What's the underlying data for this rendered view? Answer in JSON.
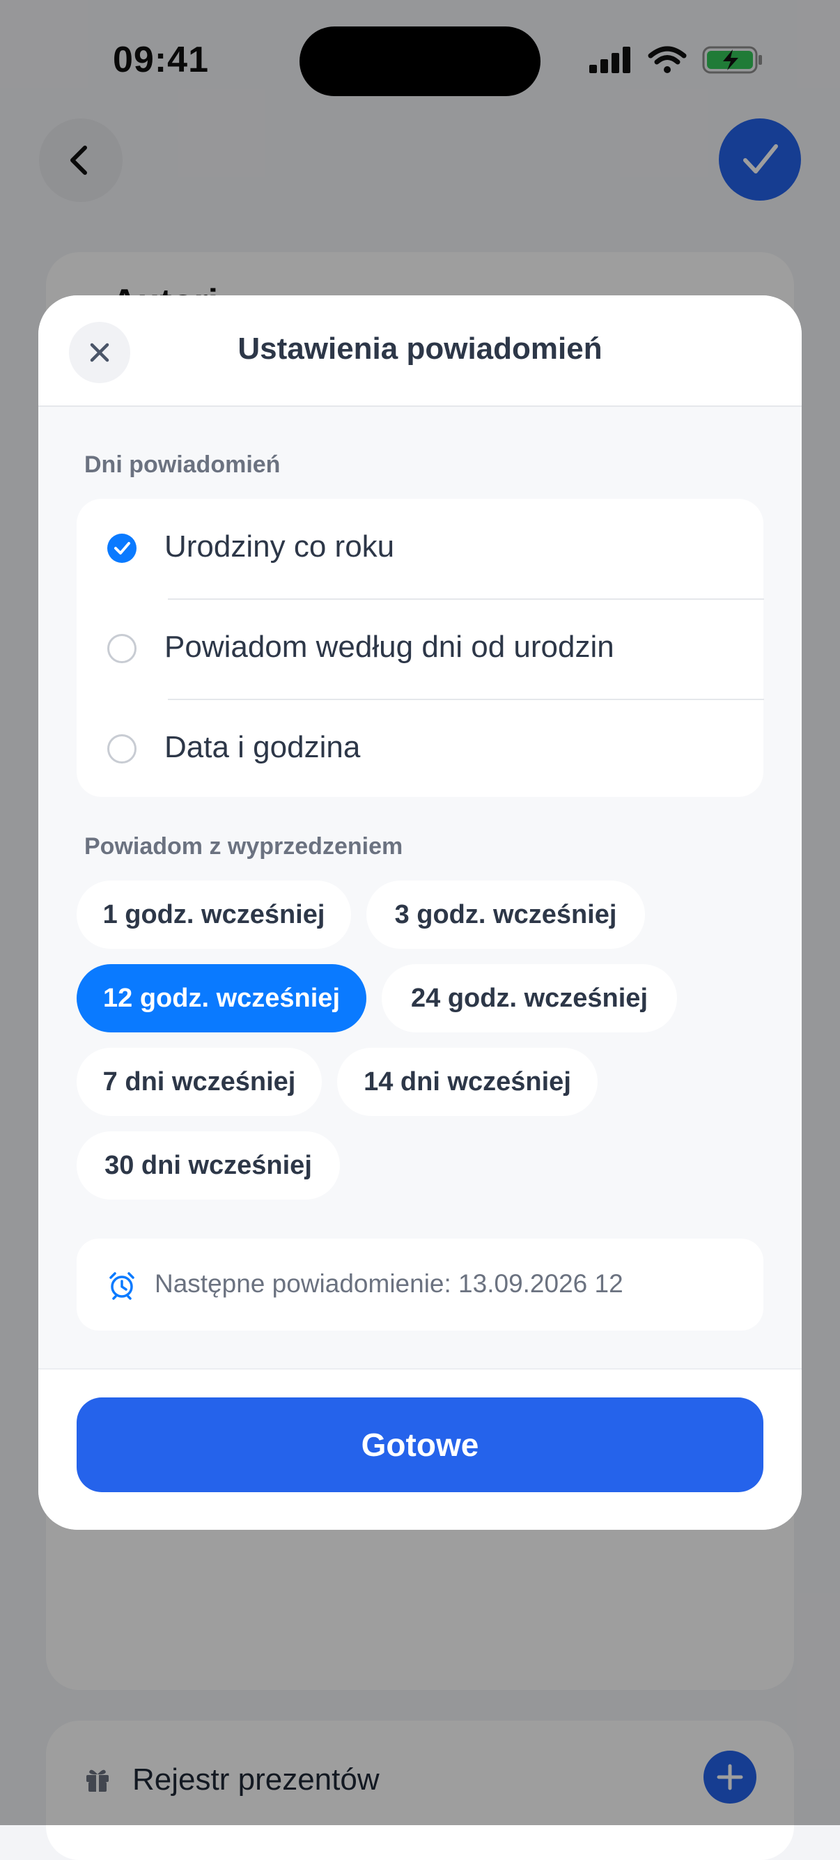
{
  "status_bar": {
    "time": "09:41"
  },
  "background": {
    "card_title": "Autori",
    "registry_label": "Rejestr prezentów"
  },
  "modal": {
    "title": "Ustawienia powiadomień",
    "days_section_label": "Dni powiadomień",
    "day_options": [
      {
        "label": "Urodziny co roku",
        "selected": true
      },
      {
        "label": "Powiadom według dni od urodzin",
        "selected": false
      },
      {
        "label": "Data i godzina",
        "selected": false
      }
    ],
    "advance_section_label": "Powiadom z wyprzedzeniem",
    "advance_options": [
      {
        "label": "1 godz. wcześniej",
        "selected": false
      },
      {
        "label": "3 godz. wcześniej",
        "selected": false
      },
      {
        "label": "12 godz. wcześniej",
        "selected": true
      },
      {
        "label": "24 godz. wcześniej",
        "selected": false
      },
      {
        "label": "7 dni wcześniej",
        "selected": false
      },
      {
        "label": "14 dni wcześniej",
        "selected": false
      },
      {
        "label": "30 dni wcześniej",
        "selected": false
      }
    ],
    "next_notification": "Następne powiadomienie: 13.09.2026 12",
    "done_label": "Gotowe"
  },
  "colors": {
    "accent": "#0a7aff",
    "primary_button": "#2563eb",
    "text_dark": "#2d3748",
    "text_muted": "#6b7280"
  }
}
